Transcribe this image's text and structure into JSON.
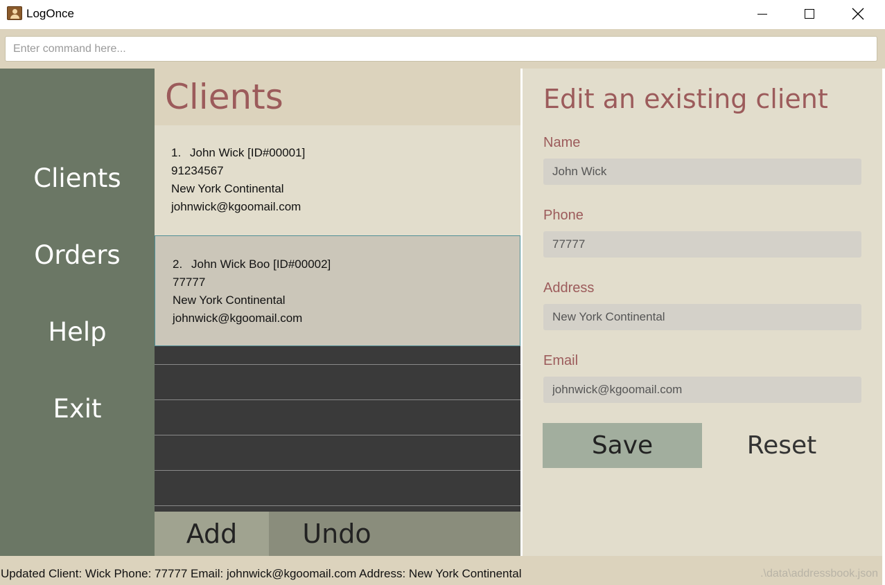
{
  "window": {
    "title": "LogOnce"
  },
  "command": {
    "placeholder": "Enter command here..."
  },
  "sidebar": {
    "items": [
      {
        "label": "Clients"
      },
      {
        "label": "Orders"
      },
      {
        "label": "Help"
      },
      {
        "label": "Exit"
      }
    ]
  },
  "list": {
    "heading": "Clients",
    "clients": [
      {
        "index": "1.",
        "name": "John Wick [ID#00001]",
        "phone": "91234567",
        "address": "New York Continental",
        "email": "johnwick@kgoomail.com"
      },
      {
        "index": "2.",
        "name": "John Wick Boo [ID#00002]",
        "phone": "77777",
        "address": "New York Continental",
        "email": "johnwick@kgoomail.com"
      }
    ],
    "add_label": "Add",
    "undo_label": "Undo"
  },
  "edit": {
    "title": "Edit an existing client",
    "name_label": "Name",
    "name_value": "John Wick",
    "phone_label": "Phone",
    "phone_value": "77777",
    "address_label": "Address",
    "address_value": "New York Continental",
    "email_label": "Email",
    "email_value": "johnwick@kgoomail.com",
    "save_label": "Save",
    "reset_label": "Reset"
  },
  "status": {
    "message": "Updated Client: Wick Phone: 77777 Email: johnwick@kgoomail.com Address: New York Continental",
    "file_path": ".\\data\\addressbook.json"
  },
  "colors": {
    "accent": "#9c5b5b",
    "sidebar_bg": "#6b7765",
    "panel_bg": "#e2ddcc",
    "header_bg": "#dcd3bd",
    "selected_border": "#4f8f97"
  }
}
